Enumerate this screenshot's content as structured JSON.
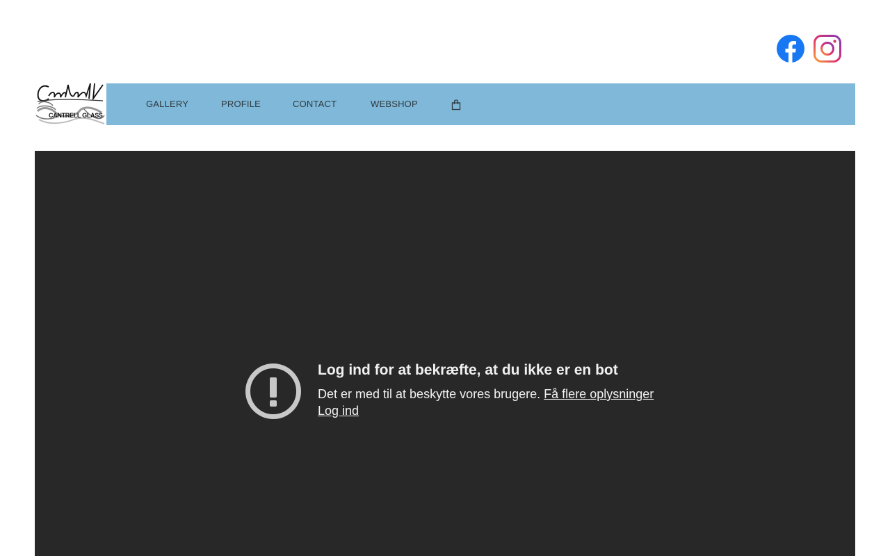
{
  "social": {
    "facebook_icon": "facebook-icon",
    "instagram_icon": "instagram-icon"
  },
  "logo": {
    "script": "Cantrell",
    "caption": "CANTRELL GLASS"
  },
  "nav": {
    "items": [
      {
        "label": "GALLERY"
      },
      {
        "label": "PROFILE"
      },
      {
        "label": "CONTACT"
      },
      {
        "label": "WEBSHOP"
      }
    ],
    "cart_icon": "shopping-bag-icon",
    "background": "#7fb8d8"
  },
  "embed": {
    "background": "#282828",
    "alert_icon": "exclamation-circle-icon",
    "title": "Log ind for at bekræfte, at du ikke er en bot",
    "body_text": "Det er med til at beskytte vores brugere.",
    "learn_more": "Få flere oplysninger",
    "login": "Log ind"
  }
}
